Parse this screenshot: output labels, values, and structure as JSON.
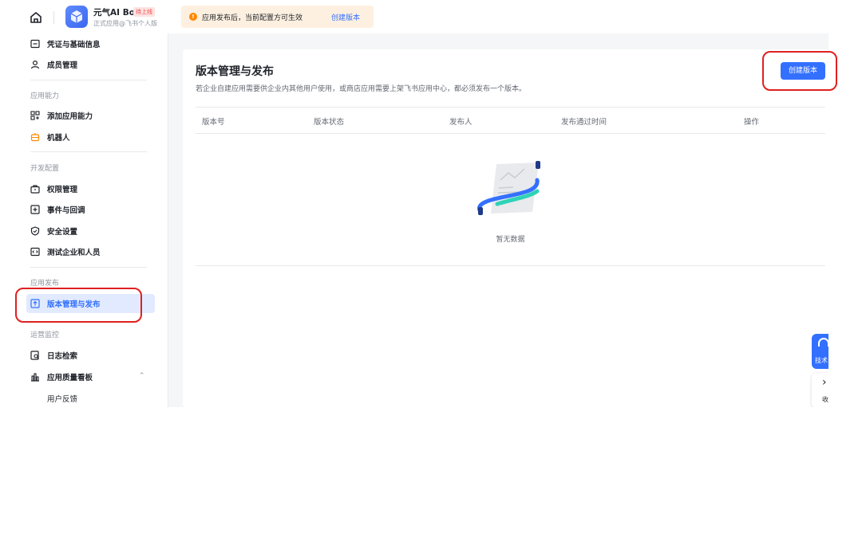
{
  "topbar": {
    "app_name": "元气AI Bot",
    "app_badge": "待上线",
    "app_sub": "正式应用@飞书个人版",
    "notice_text": "应用发布后，当前配置方可生效",
    "notice_link": "创建版本"
  },
  "sidebar": {
    "items_top": [
      {
        "label": "凭证与基础信息",
        "icon": "credential-icon"
      },
      {
        "label": "成员管理",
        "icon": "user-icon"
      }
    ],
    "group_ability": "应用能力",
    "items_ability": [
      {
        "label": "添加应用能力",
        "icon": "apps-add-icon"
      },
      {
        "label": "机器人",
        "icon": "robot-icon"
      }
    ],
    "group_dev": "开发配置",
    "items_dev": [
      {
        "label": "权限管理",
        "icon": "permission-icon"
      },
      {
        "label": "事件与回调",
        "icon": "event-icon"
      },
      {
        "label": "安全设置",
        "icon": "shield-icon"
      },
      {
        "label": "测试企业和人员",
        "icon": "test-icon"
      }
    ],
    "group_release": "应用发布",
    "items_release": [
      {
        "label": "版本管理与发布",
        "icon": "upload-icon",
        "active": true
      }
    ],
    "group_ops": "运营监控",
    "items_ops": [
      {
        "label": "日志检索",
        "icon": "log-search-icon"
      },
      {
        "label": "应用质量看板",
        "icon": "chart-icon"
      }
    ],
    "sub_items_ops": [
      "用户反馈"
    ]
  },
  "main": {
    "title": "版本管理与发布",
    "description": "若企业自建应用需要供企业内其他用户使用，或商店应用需要上架飞书应用中心，都必须发布一个版本。",
    "create_button": "创建版本",
    "columns": [
      "版本号",
      "版本状态",
      "发布人",
      "发布通过时间",
      "操作"
    ],
    "empty_text": "暂无数据"
  },
  "floating": {
    "help_label": "技术",
    "collapse_label": "收"
  },
  "colors": {
    "accent": "#3370ff",
    "annotation": "#e02020",
    "active_bg": "#e1eaff",
    "notice_bg": "#fdf0e0"
  }
}
